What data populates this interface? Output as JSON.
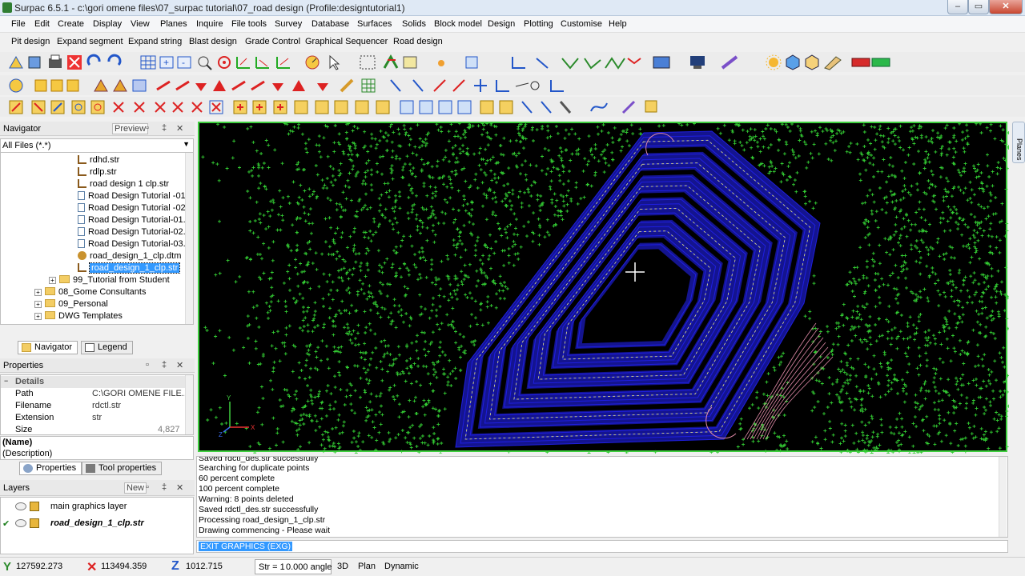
{
  "window": {
    "title": "Surpac 6.5.1 - c:\\gori omene files\\07_surpac tutorial\\07_road design (Profile:designtutorial1)"
  },
  "window_buttons": {
    "minimize": "–",
    "maximize": "▭",
    "close": "✕"
  },
  "menu": [
    "File",
    "Edit",
    "Create",
    "Display",
    "View",
    "Planes",
    "Inquire",
    "File tools",
    "Survey",
    "Database",
    "Surfaces",
    "Solids",
    "Block model",
    "Design",
    "Plotting",
    "Customise",
    "Help"
  ],
  "menu2": [
    "Pit design",
    "Expand segment",
    "Expand string",
    "Blast design",
    "Grade Control",
    "Graphical Sequencer",
    "Road design"
  ],
  "navigator": {
    "title": "Navigator",
    "preview_label": "Preview",
    "filter": "All Files (*.*)",
    "items": [
      {
        "label": "rdhd.str",
        "kind": "str"
      },
      {
        "label": "rdlp.str",
        "kind": "str"
      },
      {
        "label": "road design 1 clp.str",
        "kind": "str"
      },
      {
        "label": "Road Design Tutorial -01",
        "kind": "file"
      },
      {
        "label": "Road Design Tutorial -02",
        "kind": "file"
      },
      {
        "label": "Road Design Tutorial-01.",
        "kind": "file"
      },
      {
        "label": "Road Design Tutorial-02.",
        "kind": "file"
      },
      {
        "label": "Road Design Tutorial-03.",
        "kind": "file"
      },
      {
        "label": "road_design_1_clp.dtm",
        "kind": "dtm"
      },
      {
        "label": "road_design_1_clp.str",
        "kind": "str",
        "selected": true
      }
    ],
    "folders": [
      {
        "label": "99_Tutorial from Student"
      },
      {
        "label": "08_Gome Consultants"
      },
      {
        "label": "09_Personal"
      },
      {
        "label": "DWG Templates"
      }
    ],
    "tabs": [
      "Navigator",
      "Legend"
    ]
  },
  "properties": {
    "title": "Properties",
    "section": "Details",
    "rows": [
      {
        "key": "Path",
        "value": "C:\\GORI OMENE FILE..."
      },
      {
        "key": "Filename",
        "value": "rdctl.str"
      },
      {
        "key": "Extension",
        "value": "str"
      },
      {
        "key": "Size",
        "value": "4,827"
      }
    ],
    "name_label": "(Name)",
    "desc_label": "(Description)",
    "tabs": [
      "Properties",
      "Tool properties"
    ]
  },
  "layers": {
    "title": "Layers",
    "new_label": "New",
    "items": [
      {
        "label": "main graphics layer",
        "active": false
      },
      {
        "label": "road_design_1_clp.str",
        "active": true
      }
    ]
  },
  "planes_tab": "Planes",
  "axes": {
    "y": "Y",
    "x": "X",
    "z": "Z"
  },
  "messages": [
    "Saved rdctl_des.str successfully",
    "Searching for duplicate points",
    "60 percent complete",
    "100 percent complete",
    "Warning: 8 points deleted",
    "Saved rdctl_des.str successfully",
    "Processing road_design_1_clp.str",
    "Drawing commencing - Please wait"
  ],
  "command": "EXIT GRAPHICS (EXG)",
  "status": {
    "y_value": "127592.273",
    "x_value": "113494.359",
    "z_value": "1012.715",
    "str_label": "Str = 1",
    "angle": "0.000 angle",
    "mode_3d": "3D",
    "mode_plan": "Plan",
    "mode_dynamic": "Dynamic"
  },
  "colors": {
    "point_green": "#33cc33",
    "bench_blue": "#1f1fe0",
    "viewport_border": "#3fcf3f",
    "selection": "#3399ff"
  }
}
